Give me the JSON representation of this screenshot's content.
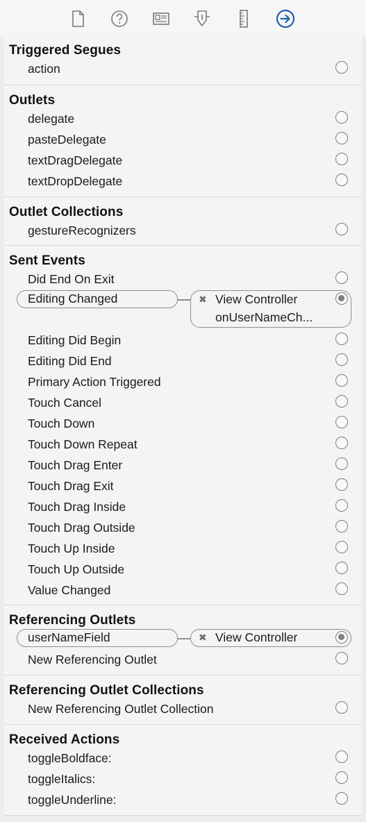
{
  "toolbar": {
    "icons": [
      "file-inspector-icon",
      "quick-help-icon",
      "identity-inspector-icon",
      "attributes-inspector-icon",
      "size-inspector-icon",
      "connections-inspector-icon"
    ]
  },
  "sections": {
    "triggered_segues": {
      "title": "Triggered Segues",
      "items": [
        "action"
      ]
    },
    "outlets": {
      "title": "Outlets",
      "items": [
        "delegate",
        "pasteDelegate",
        "textDragDelegate",
        "textDropDelegate"
      ]
    },
    "outlet_collections": {
      "title": "Outlet Collections",
      "items": [
        "gestureRecognizers"
      ]
    },
    "sent_events": {
      "title": "Sent Events",
      "items": [
        "Did End On Exit",
        "Editing Changed",
        "Editing Did Begin",
        "Editing Did End",
        "Primary Action Triggered",
        "Touch Cancel",
        "Touch Down",
        "Touch Down Repeat",
        "Touch Drag Enter",
        "Touch Drag Exit",
        "Touch Drag Inside",
        "Touch Drag Outside",
        "Touch Up Inside",
        "Touch Up Outside",
        "Value Changed"
      ],
      "connection": {
        "remove": "✖",
        "target": "View Controller",
        "action": "onUserNameCh..."
      }
    },
    "referencing_outlets": {
      "title": "Referencing Outlets",
      "items": [
        "userNameField",
        "New Referencing Outlet"
      ],
      "connection": {
        "remove": "✖",
        "target": "View Controller"
      }
    },
    "referencing_outlet_collections": {
      "title": "Referencing Outlet Collections",
      "items": [
        "New Referencing Outlet Collection"
      ]
    },
    "received_actions": {
      "title": "Received Actions",
      "items": [
        "toggleBoldface:",
        "toggleItalics:",
        "toggleUnderline:"
      ]
    }
  },
  "colors": {
    "accent": "#1f5fa8",
    "icon_gray": "#7a7a7a",
    "border": "#8e8e8e"
  }
}
